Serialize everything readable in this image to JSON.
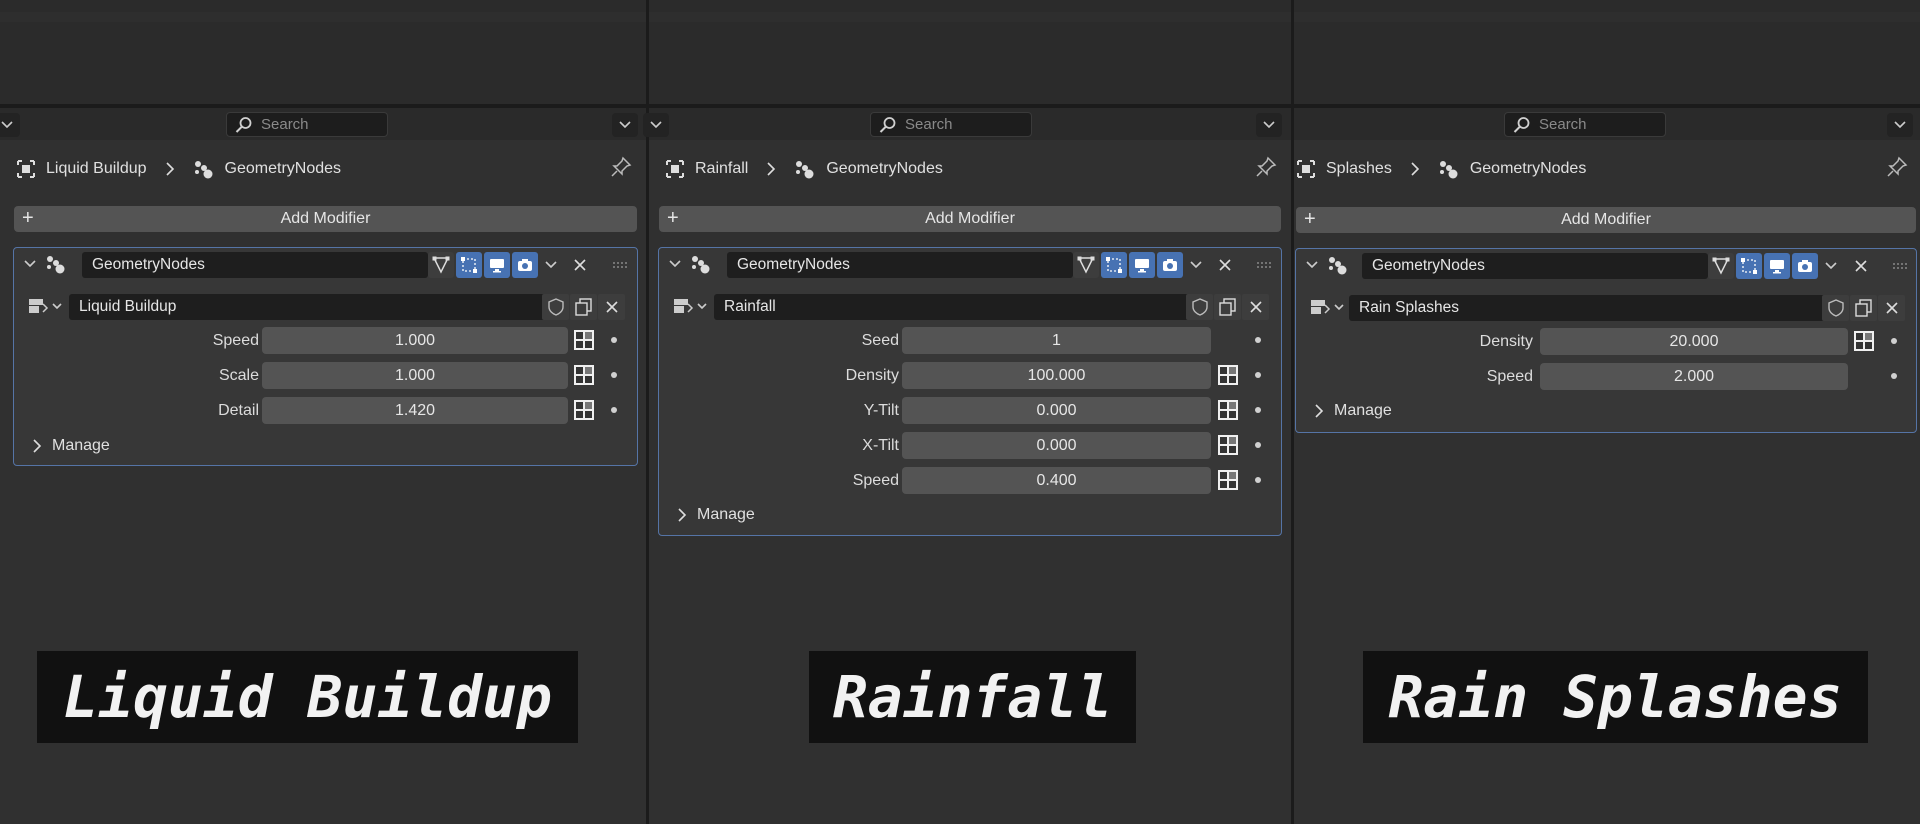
{
  "search_placeholder": "Search",
  "add_modifier_label": "Add Modifier",
  "manage_label": "Manage",
  "accent_color": "#4772b3",
  "panels": [
    {
      "object": "Liquid Buildup",
      "breadcrumb_modifier": "GeometryNodes",
      "modifier_name": "GeometryNodes",
      "node_group": "Liquid Buildup",
      "params": [
        {
          "label": "Speed",
          "value": "1.000"
        },
        {
          "label": "Scale",
          "value": "1.000"
        },
        {
          "label": "Detail",
          "value": "1.420"
        }
      ],
      "caption": "Liquid Buildup"
    },
    {
      "object": "Rainfall",
      "breadcrumb_modifier": "GeometryNodes",
      "modifier_name": "GeometryNodes",
      "node_group": "Rainfall",
      "params": [
        {
          "label": "Seed",
          "value": "1"
        },
        {
          "label": "Density",
          "value": "100.000"
        },
        {
          "label": "Y-Tilt",
          "value": "0.000"
        },
        {
          "label": "X-Tilt",
          "value": "0.000"
        },
        {
          "label": "Speed",
          "value": "0.400"
        }
      ],
      "caption": "Rainfall"
    },
    {
      "object": "Splashes",
      "breadcrumb_modifier": "GeometryNodes",
      "modifier_name": "GeometryNodes",
      "node_group": "Rain Splashes",
      "params": [
        {
          "label": "Density",
          "value": "20.000"
        },
        {
          "label": "Speed",
          "value": "2.000"
        }
      ],
      "caption": "Rain Splashes"
    }
  ]
}
